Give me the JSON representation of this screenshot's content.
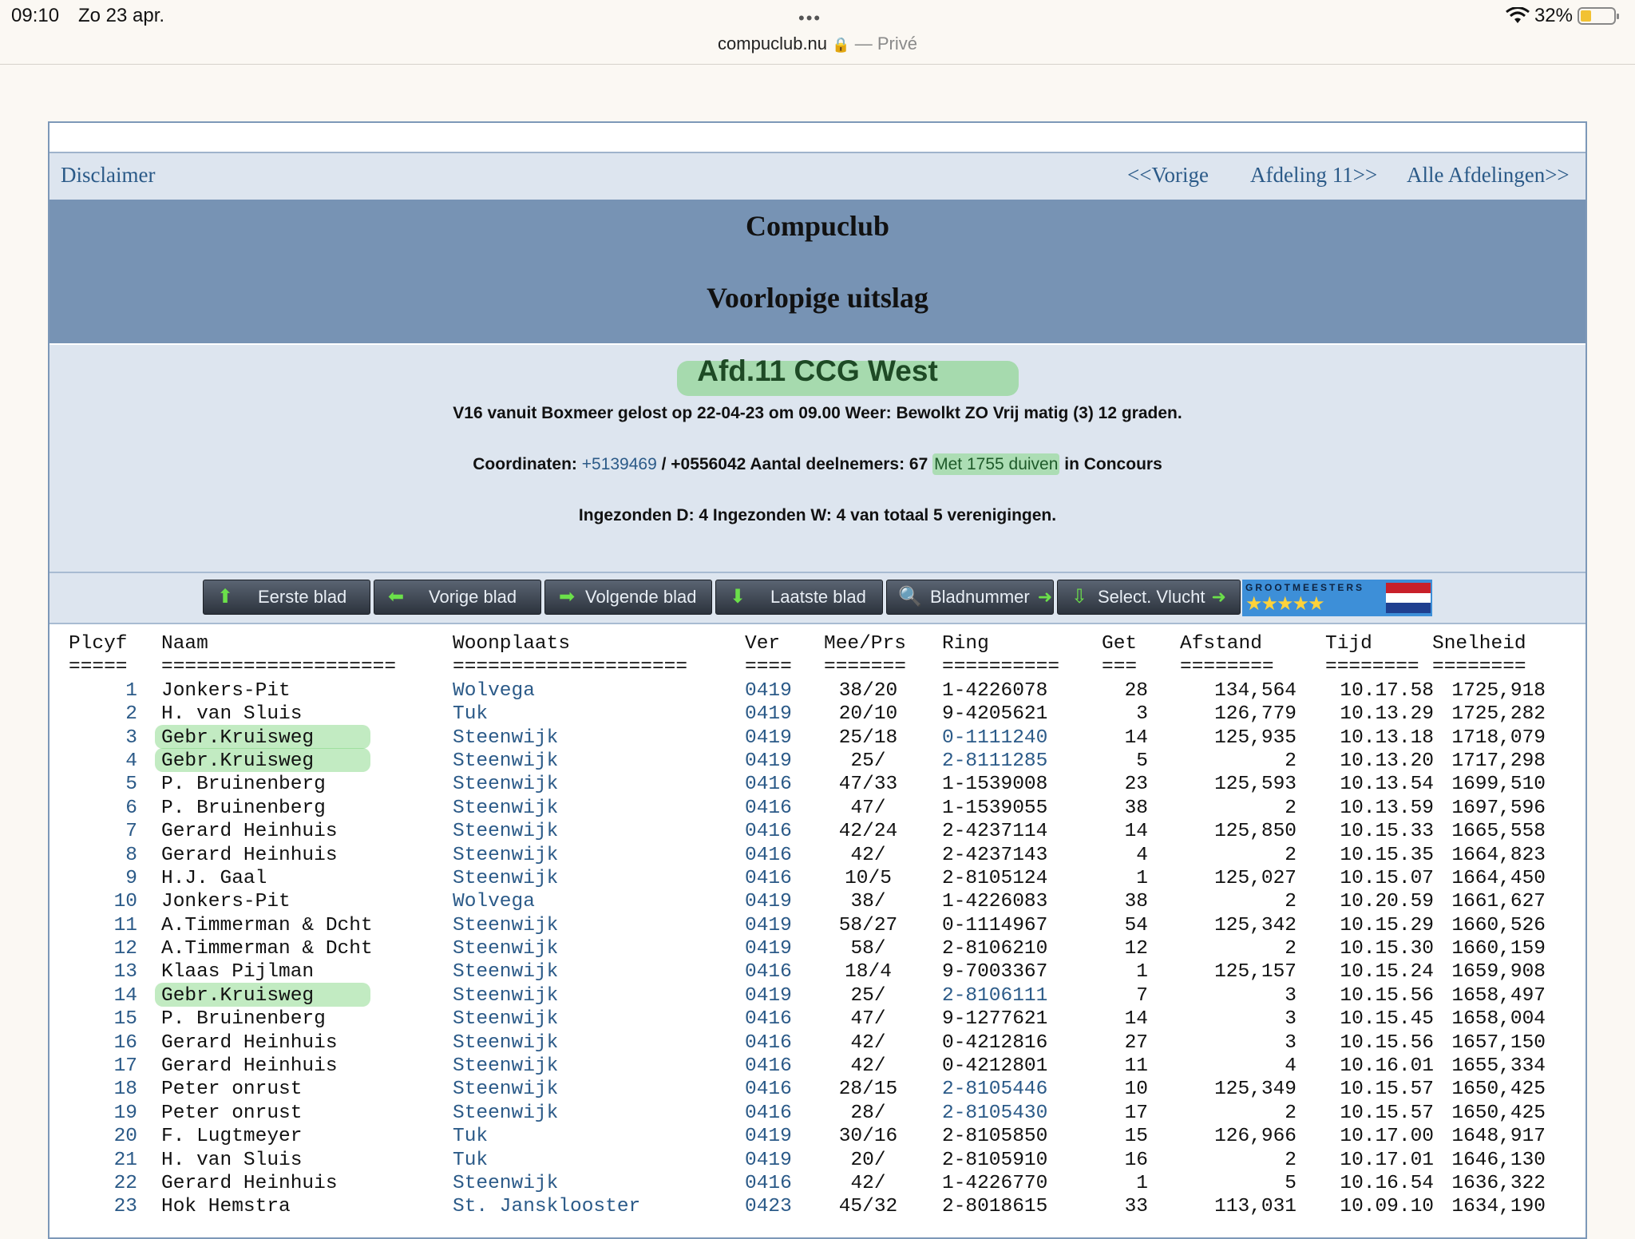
{
  "statusbar": {
    "time": "09:10",
    "date": "Zo 23 apr.",
    "url": "compuclub.nu",
    "private": "— Privé",
    "battery": "32%",
    "battery_level": 0.32
  },
  "nav": {
    "disclaimer": "Disclaimer",
    "prev": "<<Vorige",
    "afdeling": "Afdeling 11>>",
    "all": "Alle Afdelingen>>"
  },
  "header": {
    "title": "Compuclub",
    "subtitle": "Voorlopige uitslag"
  },
  "info": {
    "afdeling": "Afd.11 CCG West",
    "line1": "V16 vanuit Boxmeer gelost op 22-04-23 om 09.00 Weer: Bewolkt ZO Vrij matig (3) 12 graden.",
    "coord_label": "Coordinaten: ",
    "coord_link": "+5139469",
    "coord_rest": " / +0556042 Aantal deelnemers: 67 ",
    "duiven": "Met 1755 duiven",
    "concours": " in Concours",
    "line3": "Ingezonden D: 4 Ingezonden W: 4 van totaal 5 verenigingen."
  },
  "buttons": {
    "first": "Eerste blad",
    "prev": "Vorige blad",
    "next": "Volgende blad",
    "last": "Laatste blad",
    "page": "Bladnummer",
    "select": "Select. Vlucht",
    "grootmeesters": "GROOTMEESTERS",
    "stars": "★★★★★"
  },
  "table": {
    "headers": {
      "plc": "Plcyf",
      "naam": "Naam",
      "woon": "Woonplaats",
      "ver": "Ver",
      "mee": "Mee/Prs",
      "ring": "Ring",
      "get": "Get",
      "afst": "Afstand",
      "tijd": "Tijd",
      "snel": "Snelheid"
    },
    "separators": {
      "plc": "=====",
      "naam": "====================",
      "woon": "====================",
      "ver": "====",
      "mee": "=======",
      "ring": "==========",
      "get": "===",
      "afst": "========",
      "tijd": "========",
      "snel": "========"
    },
    "rows": [
      {
        "plc": "1",
        "naam": "Jonkers-Pit",
        "woon": "Wolvega",
        "ver": "0419",
        "mee": "38/20",
        "ring": "1-4226078",
        "get": "28",
        "afst": "134,564",
        "tijd": "10.17.58",
        "snel": "1725,918"
      },
      {
        "plc": "2",
        "naam": "H. van Sluis",
        "woon": "Tuk",
        "ver": "0419",
        "mee": "20/10",
        "ring": "9-4205621",
        "get": "3",
        "afst": "126,779",
        "tijd": "10.13.29",
        "snel": "1725,282"
      },
      {
        "plc": "3",
        "naam": "Gebr.Kruisweg",
        "woon": "Steenwijk",
        "ver": "0419",
        "mee": "25/18",
        "ring": "0-1111240",
        "get": "14",
        "afst": "125,935",
        "tijd": "10.13.18",
        "snel": "1718,079"
      },
      {
        "plc": "4",
        "naam": "Gebr.Kruisweg",
        "woon": "Steenwijk",
        "ver": "0419",
        "mee": "25/",
        "ring": "2-8111285",
        "get": "5",
        "afst": "2",
        "tijd": "10.13.20",
        "snel": "1717,298"
      },
      {
        "plc": "5",
        "naam": "P. Bruinenberg",
        "woon": "Steenwijk",
        "ver": "0416",
        "mee": "47/33",
        "ring": "1-1539008",
        "get": "23",
        "afst": "125,593",
        "tijd": "10.13.54",
        "snel": "1699,510"
      },
      {
        "plc": "6",
        "naam": "P. Bruinenberg",
        "woon": "Steenwijk",
        "ver": "0416",
        "mee": "47/",
        "ring": "1-1539055",
        "get": "38",
        "afst": "2",
        "tijd": "10.13.59",
        "snel": "1697,596"
      },
      {
        "plc": "7",
        "naam": "Gerard Heinhuis",
        "woon": "Steenwijk",
        "ver": "0416",
        "mee": "42/24",
        "ring": "2-4237114",
        "get": "14",
        "afst": "125,850",
        "tijd": "10.15.33",
        "snel": "1665,558"
      },
      {
        "plc": "8",
        "naam": "Gerard Heinhuis",
        "woon": "Steenwijk",
        "ver": "0416",
        "mee": "42/",
        "ring": "2-4237143",
        "get": "4",
        "afst": "2",
        "tijd": "10.15.35",
        "snel": "1664,823"
      },
      {
        "plc": "9",
        "naam": "H.J. Gaal",
        "woon": "Steenwijk",
        "ver": "0416",
        "mee": "10/5",
        "ring": "2-8105124",
        "get": "1",
        "afst": "125,027",
        "tijd": "10.15.07",
        "snel": "1664,450"
      },
      {
        "plc": "10",
        "naam": "Jonkers-Pit",
        "woon": "Wolvega",
        "ver": "0419",
        "mee": "38/",
        "ring": "1-4226083",
        "get": "38",
        "afst": "2",
        "tijd": "10.20.59",
        "snel": "1661,627"
      },
      {
        "plc": "11",
        "naam": "A.Timmerman & Dcht",
        "woon": "Steenwijk",
        "ver": "0419",
        "mee": "58/27",
        "ring": "0-1114967",
        "get": "54",
        "afst": "125,342",
        "tijd": "10.15.29",
        "snel": "1660,526"
      },
      {
        "plc": "12",
        "naam": "A.Timmerman & Dcht",
        "woon": "Steenwijk",
        "ver": "0419",
        "mee": "58/",
        "ring": "2-8106210",
        "get": "12",
        "afst": "2",
        "tijd": "10.15.30",
        "snel": "1660,159"
      },
      {
        "plc": "13",
        "naam": "Klaas Pijlman",
        "woon": "Steenwijk",
        "ver": "0416",
        "mee": "18/4",
        "ring": "9-7003367",
        "get": "1",
        "afst": "125,157",
        "tijd": "10.15.24",
        "snel": "1659,908"
      },
      {
        "plc": "14",
        "naam": "Gebr.Kruisweg",
        "woon": "Steenwijk",
        "ver": "0419",
        "mee": "25/",
        "ring": "2-8106111",
        "get": "7",
        "afst": "3",
        "tijd": "10.15.56",
        "snel": "1658,497"
      },
      {
        "plc": "15",
        "naam": "P. Bruinenberg",
        "woon": "Steenwijk",
        "ver": "0416",
        "mee": "47/",
        "ring": "9-1277621",
        "get": "14",
        "afst": "3",
        "tijd": "10.15.45",
        "snel": "1658,004"
      },
      {
        "plc": "16",
        "naam": "Gerard Heinhuis",
        "woon": "Steenwijk",
        "ver": "0416",
        "mee": "42/",
        "ring": "0-4212816",
        "get": "27",
        "afst": "3",
        "tijd": "10.15.56",
        "snel": "1657,150"
      },
      {
        "plc": "17",
        "naam": "Gerard Heinhuis",
        "woon": "Steenwijk",
        "ver": "0416",
        "mee": "42/",
        "ring": "0-4212801",
        "get": "11",
        "afst": "4",
        "tijd": "10.16.01",
        "snel": "1655,334"
      },
      {
        "plc": "18",
        "naam": "Peter onrust",
        "woon": "Steenwijk",
        "ver": "0416",
        "mee": "28/15",
        "ring": "2-8105446",
        "get": "10",
        "afst": "125,349",
        "tijd": "10.15.57",
        "snel": "1650,425"
      },
      {
        "plc": "19",
        "naam": "Peter onrust",
        "woon": "Steenwijk",
        "ver": "0416",
        "mee": "28/",
        "ring": "2-8105430",
        "get": "17",
        "afst": "2",
        "tijd": "10.15.57",
        "snel": "1650,425"
      },
      {
        "plc": "20",
        "naam": "F. Lugtmeyer",
        "woon": "Tuk",
        "ver": "0419",
        "mee": "30/16",
        "ring": "2-8105850",
        "get": "15",
        "afst": "126,966",
        "tijd": "10.17.00",
        "snel": "1648,917"
      },
      {
        "plc": "21",
        "naam": "H. van Sluis",
        "woon": "Tuk",
        "ver": "0419",
        "mee": "20/",
        "ring": "2-8105910",
        "get": "16",
        "afst": "2",
        "tijd": "10.17.01",
        "snel": "1646,130"
      },
      {
        "plc": "22",
        "naam": "Gerard Heinhuis",
        "woon": "Steenwijk",
        "ver": "0416",
        "mee": "42/",
        "ring": "1-4226770",
        "get": "1",
        "afst": "5",
        "tijd": "10.16.54",
        "snel": "1636,322"
      },
      {
        "plc": "23",
        "naam": "Hok Hemstra",
        "woon": "St. Jansklooster",
        "ver": "0423",
        "mee": "45/32",
        "ring": "2-8018615",
        "get": "33",
        "afst": "113,031",
        "tijd": "10.09.10",
        "snel": "1634,190"
      }
    ],
    "blue_ring_rows": [
      2,
      3,
      13,
      17,
      18
    ],
    "highlight_rows": [
      2,
      3,
      13
    ]
  }
}
